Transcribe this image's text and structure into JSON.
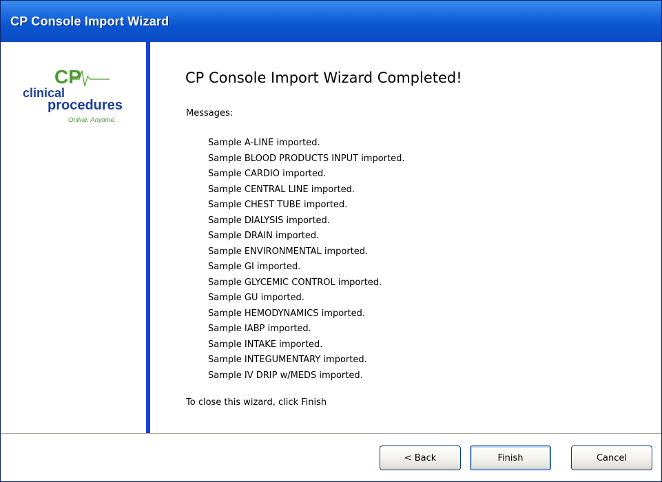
{
  "window": {
    "title": "CP Console Import Wizard"
  },
  "logo": {
    "monogram": "CP",
    "line1": "clinical",
    "line2": "procedures",
    "tagline": "Online. Anytime."
  },
  "main": {
    "heading": "CP Console Import Wizard Completed!",
    "messages_label": "Messages:",
    "messages": [
      "Sample A-LINE imported.",
      "Sample BLOOD PRODUCTS INPUT imported.",
      "Sample CARDIO imported.",
      "Sample CENTRAL LINE imported.",
      "Sample CHEST TUBE imported.",
      "Sample DIALYSIS imported.",
      "Sample DRAIN imported.",
      "Sample ENVIRONMENTAL imported.",
      "Sample GI imported.",
      "Sample GLYCEMIC CONTROL imported.",
      "Sample GU imported.",
      "Sample HEMODYNAMICS imported.",
      "Sample IABP imported.",
      "Sample INTAKE imported.",
      "Sample INTEGUMENTARY imported.",
      "Sample IV DRIP w/MEDS imported."
    ],
    "close_instruction": "To close this wizard, click Finish"
  },
  "footer": {
    "back_label": "< Back",
    "finish_label": "Finish",
    "cancel_label": "Cancel"
  },
  "colors": {
    "titlebar": "#0b55d0",
    "divider": "#1c3fd4",
    "logo_green": "#4a9a2e",
    "logo_blue": "#1b3f9c"
  }
}
